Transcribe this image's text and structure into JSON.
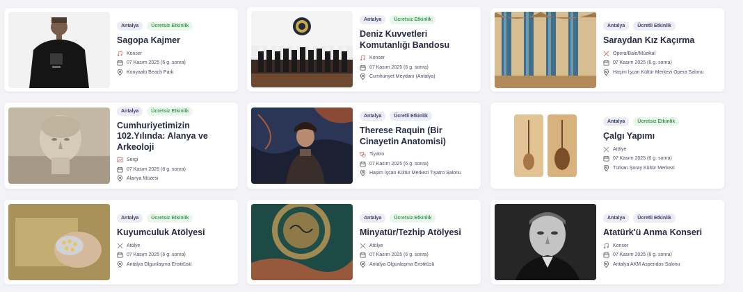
{
  "colors": {
    "accent": "#262a45",
    "free_badge_bg": "#eaf7ec",
    "free_badge_text": "#3f9a51",
    "city_badge_bg": "#ececf4"
  },
  "events": [
    {
      "city": "Antalya",
      "price": "Ücretsiz Etkinlik",
      "price_type": "free",
      "title": "Sagopa Kajmer",
      "category": "Konser",
      "category_icon": "music-icon",
      "date": "07 Kasım 2025 (6 g. sonra)",
      "venue": "Konyaaltı Beach Park",
      "image": "singer-photo"
    },
    {
      "city": "Antalya",
      "price": "Ücretsiz Etkinlik",
      "price_type": "free",
      "title": "Deniz Kuvvetleri Komutanlığı Bandosu",
      "category": "Konser",
      "category_icon": "music-icon",
      "date": "07 Kasım 2025 (6 g. sonra)",
      "venue": "Cumhuriyet Meydanı (Antalya)",
      "image": "navy-band-photo"
    },
    {
      "city": "Antalya",
      "price": "Ücretli Etkinlik",
      "price_type": "paid",
      "title": "Saraydan Kız Kaçırma",
      "category": "Opera/Bale/Müzikal",
      "category_icon": "opera-icon",
      "date": "07 Kasım 2025 (6 g. sonra)",
      "venue": "Haşim İşcan Kültür Merkezi Opera Salonu",
      "image": "palace-columns-photo"
    },
    {
      "city": "Antalya",
      "price": "Ücretsiz Etkinlik",
      "price_type": "free",
      "title": "Cumhuriyetimizin 102.Yılında: Alanya ve Arkeoloji",
      "category": "Sergi",
      "category_icon": "exhibition-icon",
      "date": "07 Kasım 2025 (6 g. sonra)",
      "venue": "Alanya Müzesi",
      "image": "statue-head-photo"
    },
    {
      "city": "Antalya",
      "price": "Ücretli Etkinlik",
      "price_type": "paid",
      "title": "Therese Raquin (Bir Cinayetin Anatomisi)",
      "category": "Tiyatro",
      "category_icon": "theatre-icon",
      "date": "07 Kasım 2025 (6 g. sonra)",
      "venue": "Haşim İşcan Kültür Merkezi Tiyatro Salonu",
      "image": "theatre-poster"
    },
    {
      "city": "Antalya",
      "price": "Ücretsiz Etkinlik",
      "price_type": "free",
      "title": "Çalgı Yapımı",
      "category": "Atölye",
      "category_icon": "workshop-icon",
      "date": "07 Kasım 2025 (6 g. sonra)",
      "venue": "Türkan Şoray Kültür Merkezi",
      "image": "instrument-photo"
    },
    {
      "city": "Antalya",
      "price": "Ücretsiz Etkinlik",
      "price_type": "free",
      "title": "Kuyumculuk Atölyesi",
      "category": "Atölye",
      "category_icon": "workshop-icon",
      "date": "07 Kasım 2025 (6 g. sonra)",
      "venue": "Antalya Olgunlaşma Enstitüsü",
      "image": "jewelry-photo"
    },
    {
      "city": "Antalya",
      "price": "Ücretsiz Etkinlik",
      "price_type": "free",
      "title": "Minyatür/Tezhip Atölyesi",
      "category": "Atölye",
      "category_icon": "workshop-icon",
      "date": "07 Kasım 2025 (6 g. sonra)",
      "venue": "Antalya Olgunlaşma Enstitüsü",
      "image": "tezhip-photo"
    },
    {
      "city": "Antalya",
      "price": "Ücretli Etkinlik",
      "price_type": "paid",
      "title": "Atatürk'ü Anma Konseri",
      "category": "Konser",
      "category_icon": "music-icon",
      "date": "07 Kasım 2025 (6 g. sonra)",
      "venue": "Antalya AKM Aspendos Salonu",
      "image": "portrait-photo"
    }
  ]
}
